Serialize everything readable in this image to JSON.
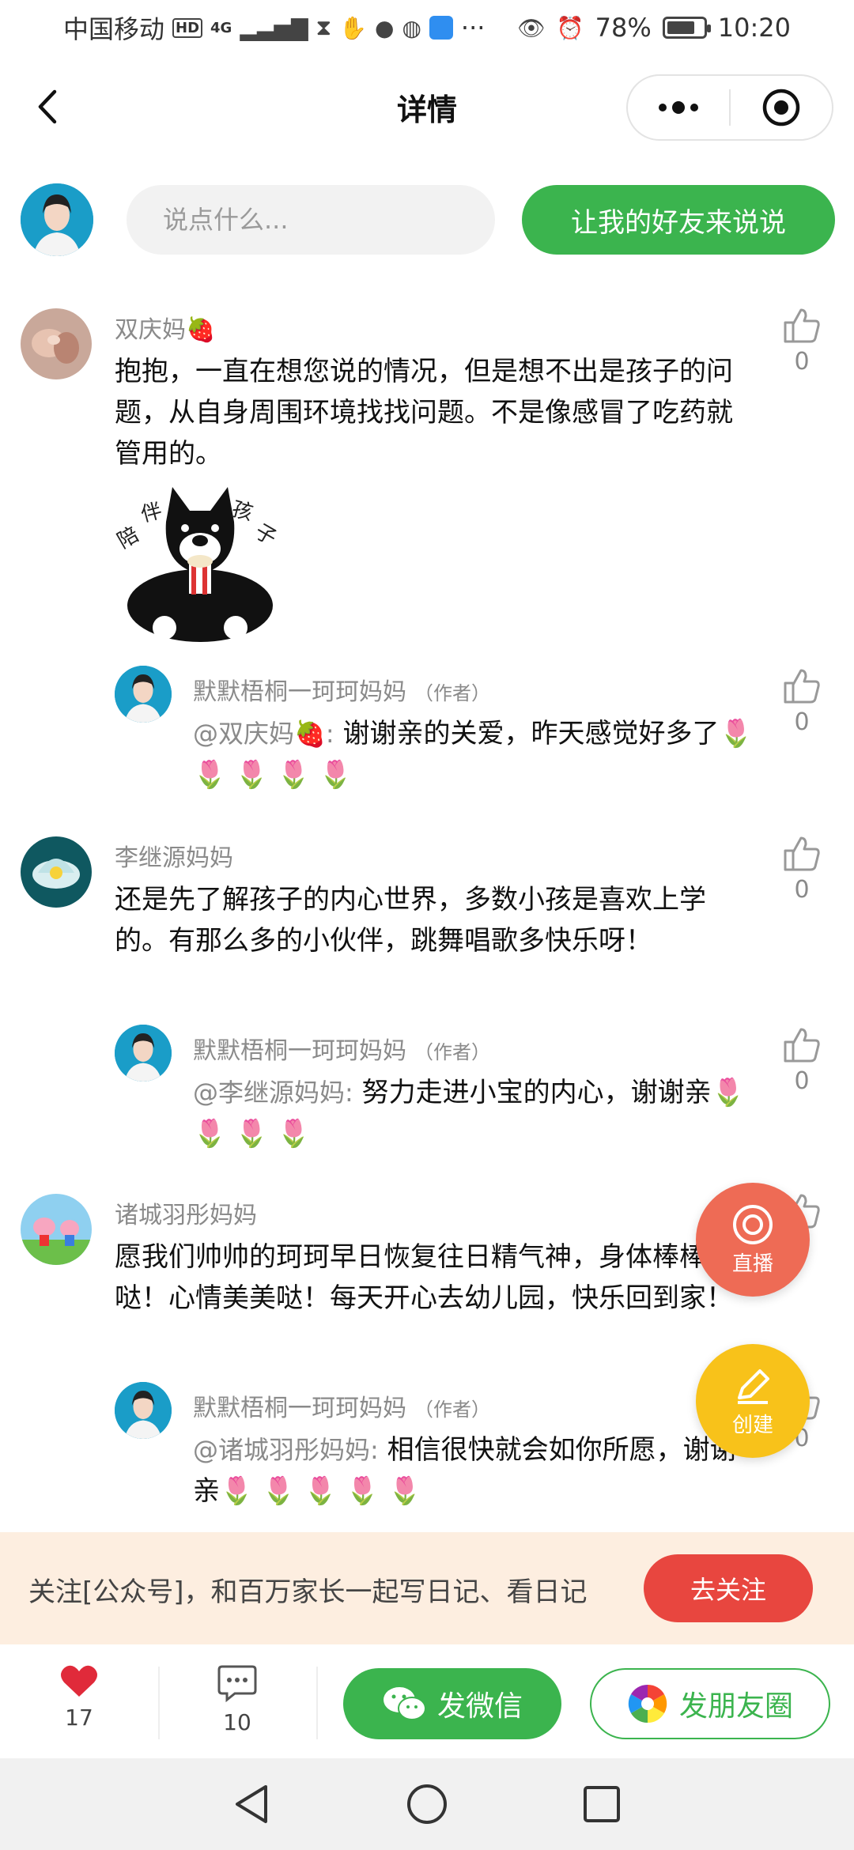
{
  "status_bar": {
    "carrier": "中国移动",
    "hd": "HD",
    "net": "4G",
    "battery_pct": "78%",
    "battery_level": 0.78,
    "time": "10:20",
    "dots": "···"
  },
  "header": {
    "title": "详情"
  },
  "compose": {
    "placeholder": "说点什么...",
    "invite_label": "让我的好友来说说"
  },
  "comments": [
    {
      "username": "双庆妈🍓",
      "text": "抱抱，一直在想您说的情况，但是想不出是孩子的问题，从自身周围环境找找问题。不是像感冒了吃药就管用的。",
      "sticker_text": [
        "陪",
        "伴",
        "孩",
        "子"
      ],
      "likes": "0",
      "reply": {
        "author": "默默梧桐一珂珂妈妈",
        "tag": "（作者）",
        "mention": "@双庆妈🍓:",
        "text": "谢谢亲的关爱，昨天感觉好多了🌷 🌷 🌷 🌷 🌷",
        "likes": "0"
      }
    },
    {
      "username": "李继源妈妈",
      "text": "还是先了解孩子的内心世界，多数小孩是喜欢上学的。有那么多的小伙伴，跳舞唱歌多快乐呀！",
      "likes": "0",
      "reply": {
        "author": "默默梧桐一珂珂妈妈",
        "tag": "（作者）",
        "mention": "@李继源妈妈:",
        "text": "努力走进小宝的内心，谢谢亲🌷 🌷 🌷 🌷",
        "likes": "0"
      }
    },
    {
      "username": "诸城羽彤妈妈",
      "text": "愿我们帅帅的珂珂早日恢复往日精气神，身体棒棒哒！心情美美哒！每天开心去幼儿园，快乐回到家！",
      "likes": "0",
      "reply": {
        "author": "默默梧桐一珂珂妈妈",
        "tag": "（作者）",
        "mention": "@诸城羽彤妈妈:",
        "text": "相信很快就会如你所愿，谢谢亲🌷 🌷 🌷 🌷 🌷",
        "likes": "0"
      }
    }
  ],
  "floating": {
    "live_label": "直播",
    "create_label": "创建"
  },
  "banner": {
    "text": "关注[公众号]，和百万家长一起写日记、看日记",
    "button": "去关注"
  },
  "actions": {
    "likes_count": "17",
    "comments_count": "10",
    "wechat_label": "发微信",
    "moments_label": "发朋友圈"
  },
  "colors": {
    "green": "#3bb44e",
    "red": "#e8463f",
    "orange_red": "#ee6b55",
    "yellow": "#f8c21a",
    "banner_bg": "#fdeee0"
  }
}
